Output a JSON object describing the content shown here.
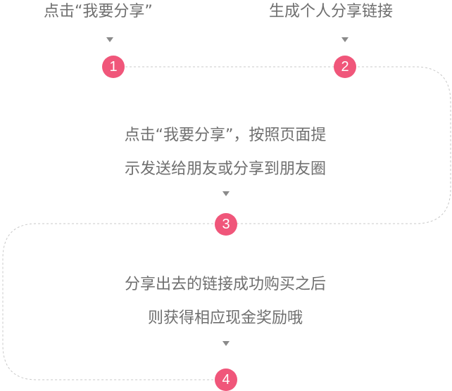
{
  "accent_color": "#f0567a",
  "steps": [
    {
      "number": "1",
      "lines": [
        "点击“我要分享”"
      ]
    },
    {
      "number": "2",
      "lines": [
        "生成个人分享链接"
      ]
    },
    {
      "number": "3",
      "lines": [
        "点击“我要分享”，按照页面提",
        "示发送给朋友或分享到朋友圈"
      ]
    },
    {
      "number": "4",
      "lines": [
        "分享出去的链接成功购买之后",
        "则获得相应现金奖励哦"
      ]
    }
  ]
}
